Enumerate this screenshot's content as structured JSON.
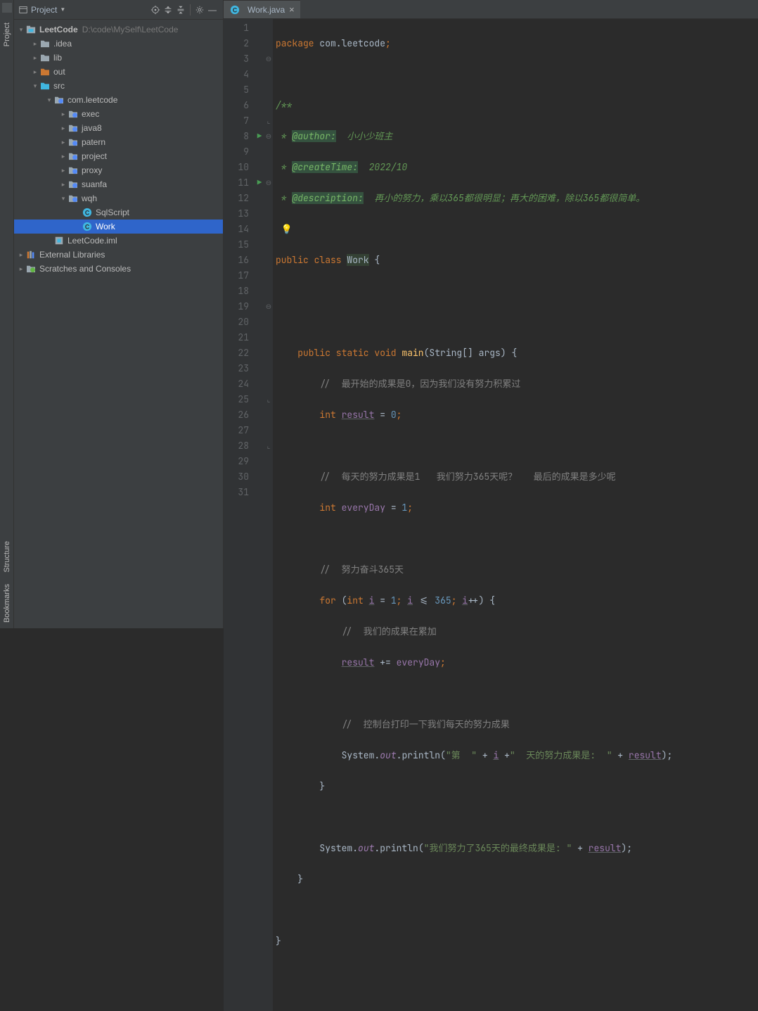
{
  "rail": {
    "project": "Project",
    "structure": "Structure",
    "bookmarks": "Bookmarks"
  },
  "pane": {
    "title": "Project"
  },
  "tree": {
    "root": {
      "name": "LeetCode",
      "path": "D:\\code\\MySelf\\LeetCode"
    },
    "idea": ".idea",
    "lib": "lib",
    "out": "out",
    "src": "src",
    "pkg": "com.leetcode",
    "exec": "exec",
    "java8": "java8",
    "patern": "patern",
    "project": "project",
    "proxy": "proxy",
    "suanfa": "suanfa",
    "wqh": "wqh",
    "sqlscript": "SqlScript",
    "work": "Work",
    "iml": "LeetCode.iml",
    "extlib": "External Libraries",
    "scratch": "Scratches and Consoles"
  },
  "tab": {
    "name": "Work.java"
  },
  "code": {
    "l1": {
      "a": "package ",
      "b": "com.leetcode",
      "c": ";"
    },
    "l3": "/**",
    "l4": {
      "a": " * ",
      "tag": "@author:",
      "txt": "  小小少班主"
    },
    "l5": {
      "a": " * ",
      "tag": "@createTime:",
      "txt": "  2022/10"
    },
    "l6": {
      "a": " * ",
      "tag": "@description:",
      "txt": "  再小的努力，乘以365都很明显；再大的困难，除以365都很简单。"
    },
    "l7": " */",
    "l8": {
      "a": "public class ",
      "cls": "Work",
      "b": " {"
    },
    "l11": {
      "a": "    ",
      "kw": "public static void ",
      "m": "main",
      "p": "(",
      "t": "String",
      "br": "[] ",
      "arg": "args",
      "e": ") {"
    },
    "l12": "        //  最开始的成果是0，因为我们没有努力积累过",
    "l13": {
      "a": "        ",
      "kw": "int ",
      "v": "result",
      "b": " = ",
      "n": "0",
      "c": ";"
    },
    "l15": "        //  每天的努力成果是1   我们努力365天呢？   最后的成果是多少呢",
    "l16": {
      "a": "        ",
      "kw": "int ",
      "v": "everyDay",
      "b": " = ",
      "n": "1",
      "c": ";"
    },
    "l18": "        //  努力奋斗365天",
    "l19": {
      "a": "        ",
      "kw": "for ",
      "p": "(",
      "kw2": "int ",
      "i": "i",
      "eq": " = ",
      "n1": "1",
      "sc": "; ",
      "i2": "i",
      "le": " <= ",
      "n2": "365",
      "sc2": "; ",
      "i3": "i",
      "inc": "++) {"
    },
    "l20": "            //  我们的成果在累加",
    "l21": {
      "a": "            ",
      "v": "result",
      "op": " += ",
      "v2": "everyDay",
      "c": ";"
    },
    "l23": "            //  控制台打印一下我们每天的努力成果",
    "l24": {
      "a": "            ",
      "sys": "System.",
      "out": "out",
      "d": ".",
      "m": "println",
      "p": "(",
      "s1": "\"第  \"",
      "pl": " + ",
      "i": "i",
      "pl2": " +",
      "s2": "\"  天的努力成果是:  \"",
      "pl3": " + ",
      "r": "result",
      "e": ");"
    },
    "l25": "        }",
    "l27": {
      "a": "        ",
      "sys": "System.",
      "out": "out",
      "d": ".",
      "m": "println",
      "p": "(",
      "s1": "\"我们努力了365天的最终成果是: \"",
      "pl": " + ",
      "r": "result",
      "e": ");"
    },
    "l28": "    }",
    "l30": "}"
  }
}
